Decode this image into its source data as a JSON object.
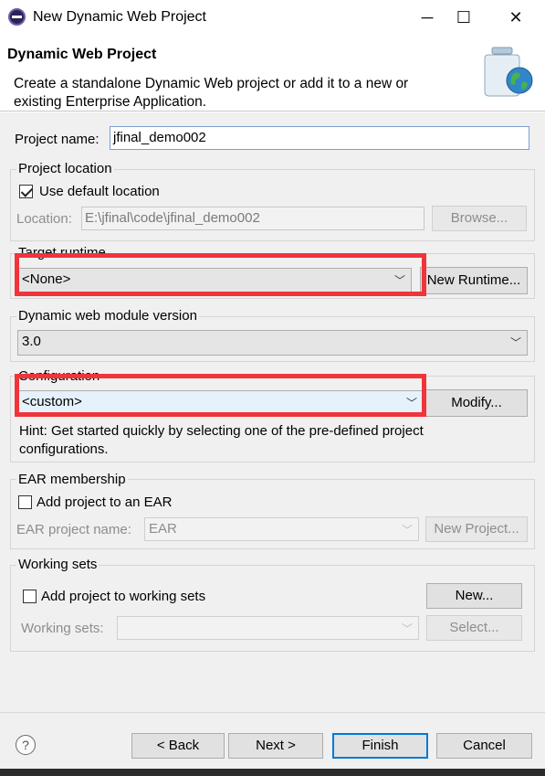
{
  "window": {
    "title": "New Dynamic Web Project",
    "controls": {
      "minimize": "─",
      "maximize": "☐",
      "close": "✕"
    }
  },
  "header": {
    "title": "Dynamic Web Project",
    "description": "Create a standalone Dynamic Web project or add it to a new or existing Enterprise Application."
  },
  "project_name": {
    "label": "Project name:",
    "value": "jfinal_demo002"
  },
  "project_location": {
    "group_title": "Project location",
    "use_default_label": "Use default location",
    "use_default_checked": true,
    "location_label": "Location:",
    "location_value": "E:\\jfinal\\code\\jfinal_demo002",
    "browse_label": "Browse..."
  },
  "target_runtime": {
    "group_title": "Target runtime",
    "selected": "<None>",
    "new_runtime_label": "New Runtime..."
  },
  "module_version": {
    "group_title": "Dynamic web module version",
    "selected": "3.0"
  },
  "configuration": {
    "group_title": "Configuration",
    "selected": "<custom>",
    "modify_label": "Modify...",
    "hint": "Hint: Get started quickly by selecting one of the pre-defined project configurations."
  },
  "ear_membership": {
    "group_title": "EAR membership",
    "add_label": "Add project to an EAR",
    "add_checked": false,
    "ear_name_label": "EAR project name:",
    "ear_name_value": "EAR",
    "new_project_label": "New Project..."
  },
  "working_sets": {
    "group_title": "Working sets",
    "add_label": "Add project to working sets",
    "add_checked": false,
    "new_label": "New...",
    "sets_label": "Working sets:",
    "sets_value": "",
    "select_label": "Select..."
  },
  "footer": {
    "help": "?",
    "back_label": "< Back",
    "next_label": "Next >",
    "finish_label": "Finish",
    "cancel_label": "Cancel"
  },
  "colors": {
    "annotation_red": "#f0343a",
    "accent_blue": "#0078d7"
  },
  "chevron": "﹀"
}
